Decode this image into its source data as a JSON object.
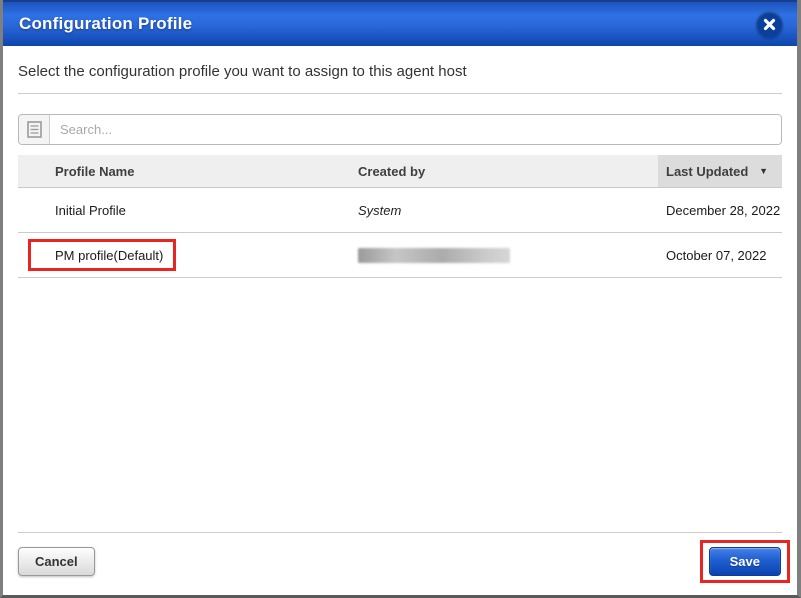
{
  "dialog": {
    "title": "Configuration Profile",
    "subtitle": "Select the configuration profile you want to assign to this agent host"
  },
  "search": {
    "placeholder": "Search..."
  },
  "icons": {
    "close": "x-in-circle",
    "search_addon": "list-document",
    "sort_desc": "▼"
  },
  "table": {
    "columns": [
      {
        "label": "Profile Name"
      },
      {
        "label": "Created by"
      },
      {
        "label": "Last Updated",
        "sorted": "desc"
      }
    ],
    "rows": [
      {
        "profile_name": "Initial Profile",
        "created_by": "System",
        "last_updated": "December 28, 2022",
        "highlighted": false
      },
      {
        "profile_name": "PM profile(Default)",
        "created_by": "",
        "created_by_redacted": true,
        "last_updated": "October 07, 2022",
        "highlighted": true
      }
    ]
  },
  "buttons": {
    "cancel": "Cancel",
    "save": "Save"
  },
  "colors": {
    "header_blue_top": "#2e71e6",
    "header_blue_bottom": "#0c46ad",
    "sorted_column_bg": "#dcdcdc",
    "table_header_bg": "#efefef",
    "annotation_red": "#e8261f",
    "save_button_blue": "#1f5ed0",
    "border_gray": "#7f7f7f"
  }
}
